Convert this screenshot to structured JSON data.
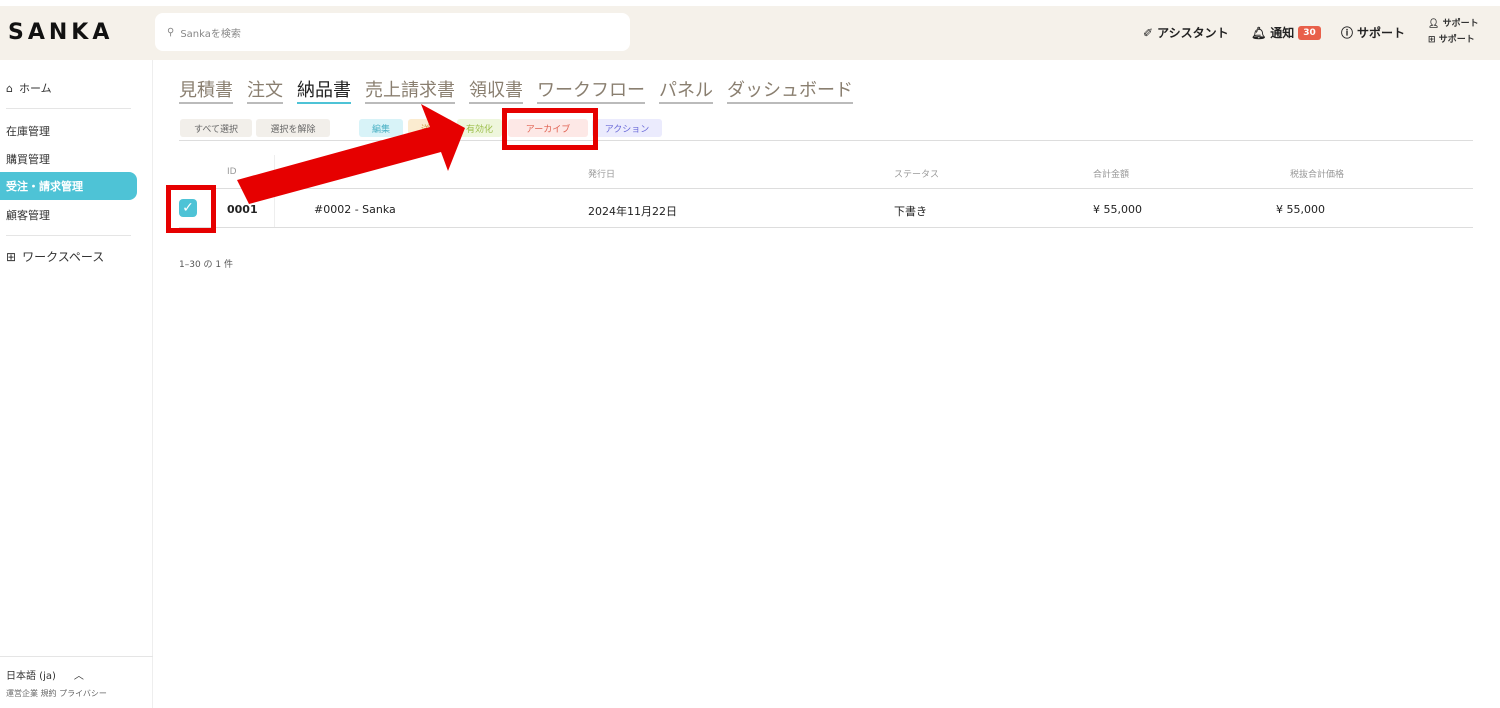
{
  "header": {
    "logo": "SANKA",
    "search_placeholder": "Sankaを検索",
    "assistant": "アシスタント",
    "notifications": "通知",
    "notification_count": "30",
    "support": "サポート",
    "user_line1": "サポート",
    "user_line2": "サポート"
  },
  "sidebar": {
    "home": "ホーム",
    "items": [
      "在庫管理",
      "購買管理",
      "受注・請求管理",
      "顧客管理"
    ],
    "workspace": "ワークスペース",
    "language": "日本語 (ja)",
    "footer_links": "運営企業 規約 プライバシー"
  },
  "tabs": [
    "見積書",
    "注文",
    "納品書",
    "売上請求書",
    "領収書",
    "ワークフロー",
    "パネル",
    "ダッシュボード"
  ],
  "actions": {
    "select_all": "すべて選択",
    "deselect": "選択を解除",
    "edit": "編集",
    "send": "送信",
    "enable": "有効化",
    "archive": "アーカイブ",
    "action": "アクション"
  },
  "table": {
    "headers": [
      "ID",
      "",
      "発行日",
      "ステータス",
      "合計金額",
      "税抜合計価格"
    ],
    "rows": [
      {
        "id": "0001",
        "name": "#0002 - Sanka",
        "date": "2024年11月22日",
        "status": "下書き",
        "total": "¥ 55,000",
        "subtotal": "¥ 55,000",
        "checked": true
      }
    ]
  },
  "pagination": "1–30 の 1 件",
  "colors": {
    "accent": "#4ec3d6",
    "highlight": "#e60000",
    "badge": "#e8604a"
  }
}
